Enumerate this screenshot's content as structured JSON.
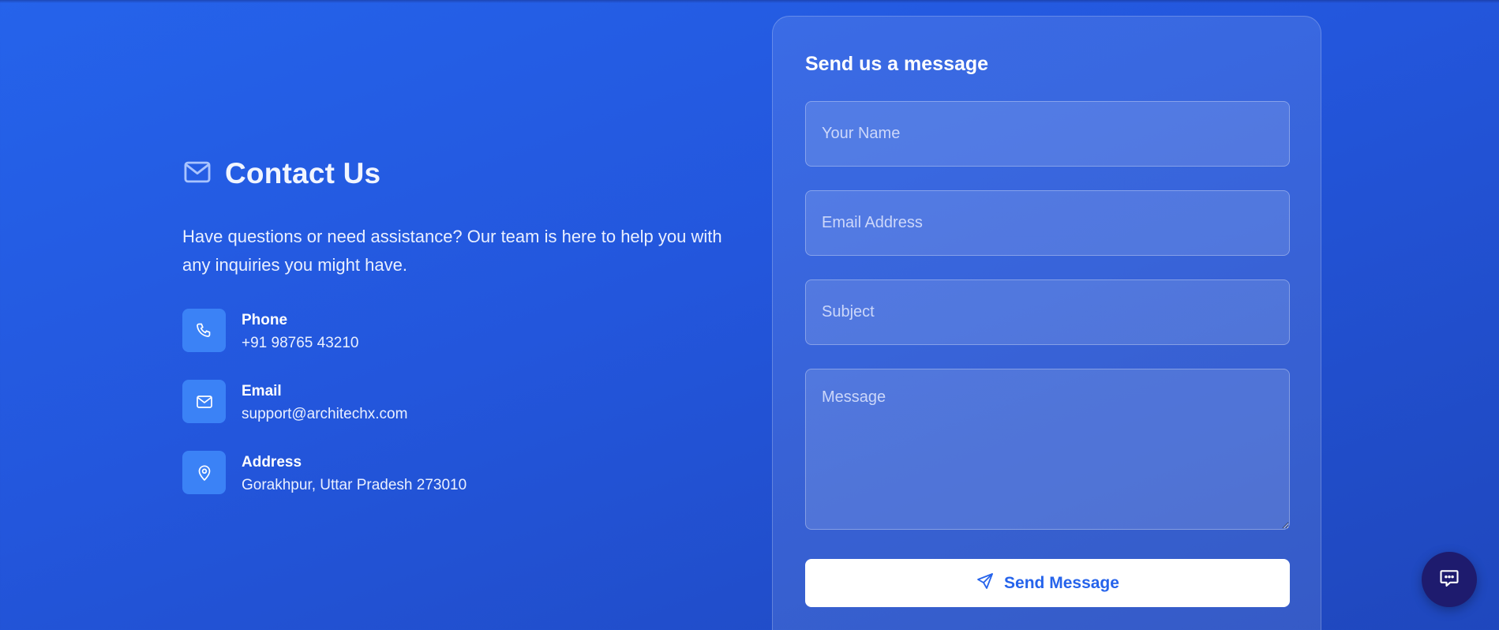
{
  "contact": {
    "heading": "Contact Us",
    "intro": "Have questions or need assistance? Our team is here to help you with any inquiries you might have.",
    "items": [
      {
        "label": "Phone",
        "value": "+91 98765 43210",
        "icon": "phone-icon"
      },
      {
        "label": "Email",
        "value": "support@architechx.com",
        "icon": "mail-icon"
      },
      {
        "label": "Address",
        "value": "Gorakhpur, Uttar Pradesh 273010",
        "icon": "map-pin-icon"
      }
    ]
  },
  "form": {
    "title": "Send us a message",
    "name_placeholder": "Your Name",
    "email_placeholder": "Email Address",
    "subject_placeholder": "Subject",
    "message_placeholder": "Message",
    "submit_label": "Send Message"
  },
  "chat": {
    "icon": "chat-icon"
  },
  "colors": {
    "background": "#2563eb",
    "icon_tile": "#3b82f6",
    "button_text": "#2563eb",
    "chat_button": "#1e1b6e"
  }
}
